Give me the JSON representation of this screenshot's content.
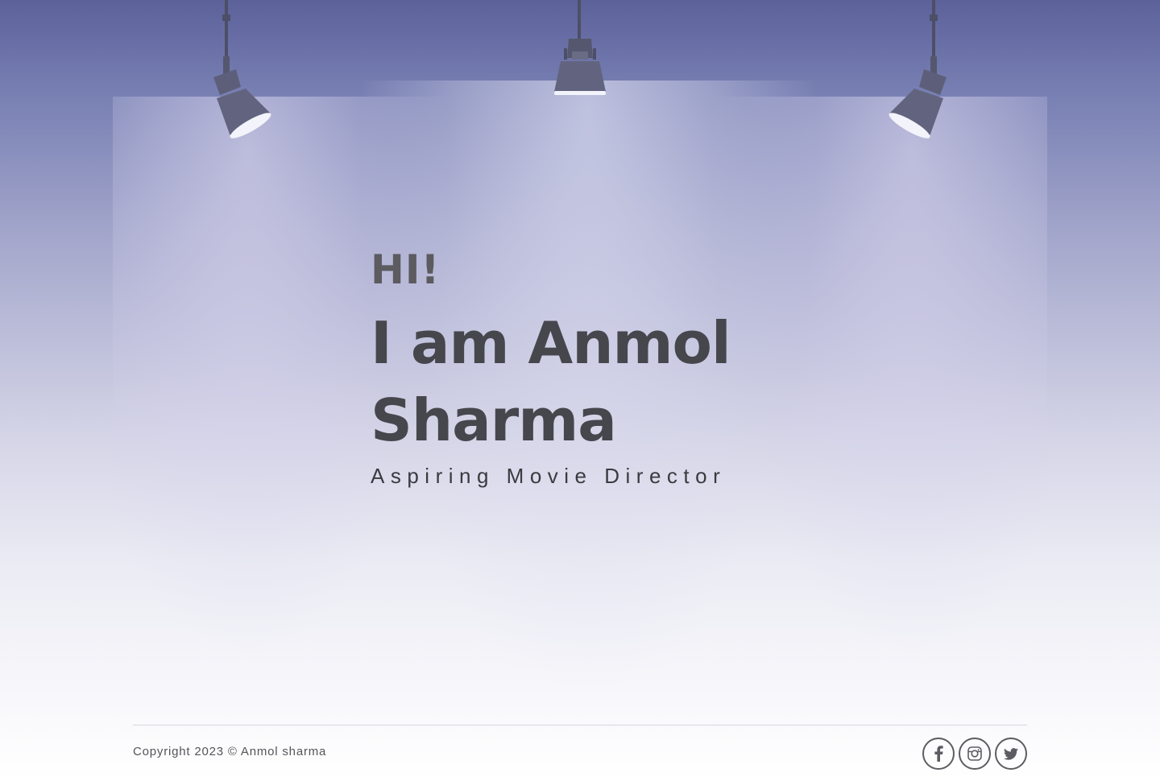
{
  "hero": {
    "greeting": "HI!",
    "name_line1": "I am Anmol",
    "name_line2": "Sharma",
    "tagline": "Aspiring Movie Director"
  },
  "footer": {
    "copyright": "Copyright 2023 © Anmol sharma",
    "socials": [
      {
        "icon": "facebook-icon"
      },
      {
        "icon": "instagram-icon"
      },
      {
        "icon": "twitter-icon"
      }
    ]
  },
  "colors": {
    "background_top": "#5c619a",
    "background_bottom": "#ffffff",
    "heading": "#46474d",
    "greeting": "#5b5b60",
    "lamp": "#5d5f7a"
  }
}
